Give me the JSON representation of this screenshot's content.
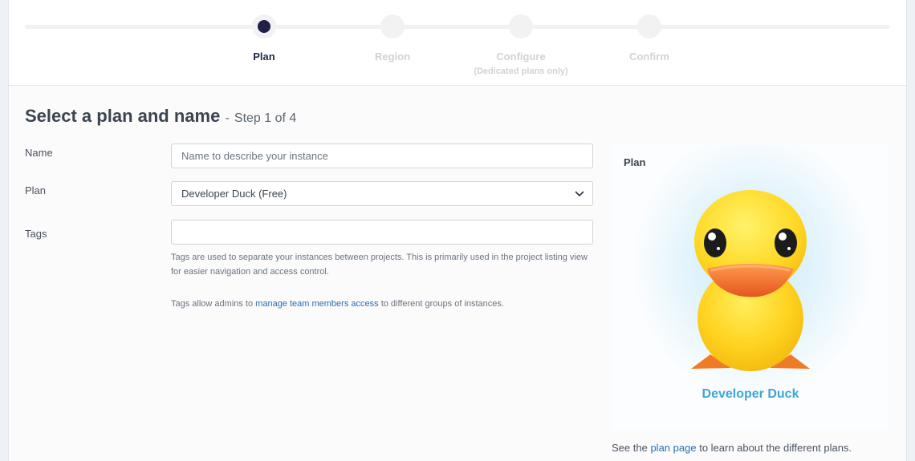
{
  "stepper": {
    "steps": [
      {
        "label": "Plan",
        "sub": ""
      },
      {
        "label": "Region",
        "sub": ""
      },
      {
        "label": "Configure",
        "sub": "(Dedicated plans only)"
      },
      {
        "label": "Confirm",
        "sub": ""
      }
    ]
  },
  "header": {
    "title": "Select a plan and name",
    "separator": "-",
    "step": "Step 1 of 4"
  },
  "form": {
    "name_label": "Name",
    "name_placeholder": "Name to describe your instance",
    "plan_label": "Plan",
    "plan_value": "Developer Duck (Free)",
    "tags_label": "Tags",
    "tags_value": "",
    "tags_help_1": "Tags are used to separate your instances between projects. This is primarily used in the project listing view for easier navigation and access control.",
    "tags_help_2_before": "Tags allow admins to",
    "tags_help_2_link": "manage team members access",
    "tags_help_2_after": "to different groups of instances."
  },
  "plan_card": {
    "title": "Plan",
    "plan_name": "Developer Duck",
    "icon": "duck-icon",
    "footer_before": "See the",
    "footer_link": "plan page",
    "footer_after": "to learn about the different plans."
  },
  "colors": {
    "active_step": "#1f1f47",
    "link": "#2a6fb0",
    "plan_name": "#3da5d9",
    "duck_body": "#ffd21f",
    "duck_beak": "#f27b35"
  }
}
